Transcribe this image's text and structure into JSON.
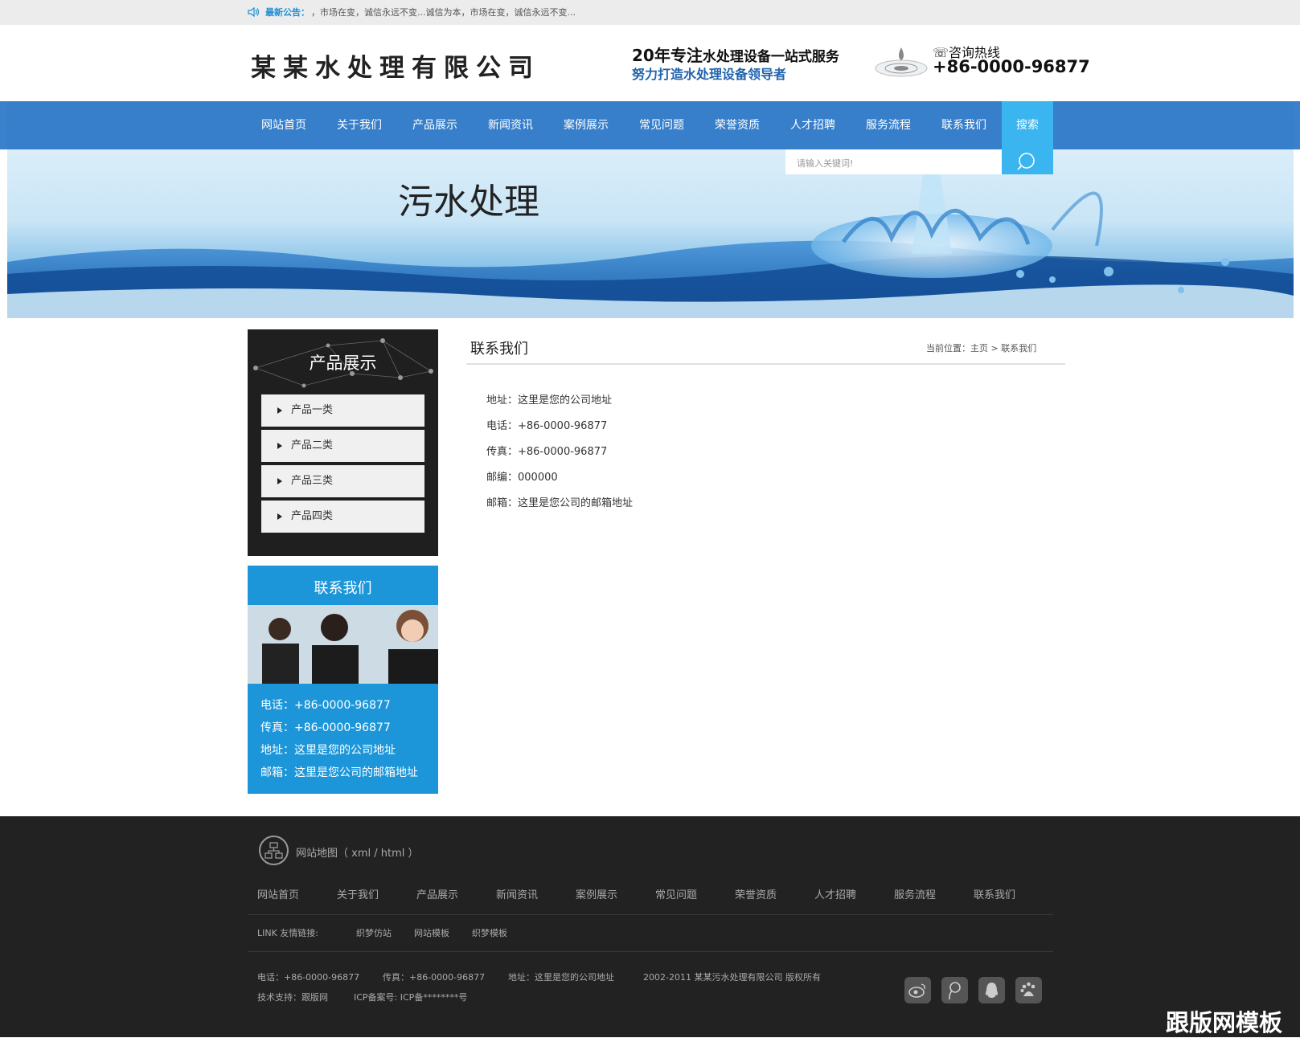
{
  "topbar": {
    "notice_label": "最新公告：",
    "notice_text": "，市场在变，诚信永远不变...诚信为本，市场在变，诚信永远不变..."
  },
  "header": {
    "company": "某某水处理有限公司",
    "slogan_line1_big": "20年专注",
    "slogan_line1_small": "水处理设备一站式服务",
    "slogan_line2": "努力打造水处理设备领导者",
    "hotline_label": "咨询热线",
    "hotline_number": "+86-0000-96877"
  },
  "nav": {
    "items": [
      "网站首页",
      "关于我们",
      "产品展示",
      "新闻资讯",
      "案例展示",
      "常见问题",
      "荣誉资质",
      "人才招聘",
      "服务流程",
      "联系我们"
    ],
    "search_label": "搜索",
    "search_placeholder": "请输入关键词!"
  },
  "banner": {
    "title": "污水处理"
  },
  "sidebar": {
    "products_title": "产品展示",
    "products": [
      "产品一类",
      "产品二类",
      "产品三类",
      "产品四类"
    ],
    "contact_title": "联系我们",
    "contact_lines": [
      "电话：+86-0000-96877",
      "传真：+86-0000-96877",
      "地址：这里是您的公司地址",
      "邮箱：这里是您公司的邮箱地址"
    ]
  },
  "main": {
    "title": "联系我们",
    "breadcrumb_prefix": "当前位置：",
    "breadcrumb_home": "主页",
    "breadcrumb_sep": ">",
    "breadcrumb_current": "联系我们",
    "info": [
      "地址：这里是您的公司地址",
      "电话：+86-0000-96877",
      "传真：+86-0000-96877",
      "邮编：000000",
      "邮箱：这里是您公司的邮箱地址"
    ]
  },
  "footer": {
    "sitemap": "网站地图（ xml / html ）",
    "nav": [
      "网站首页",
      "关于我们",
      "产品展示",
      "新闻资讯",
      "案例展示",
      "常见问题",
      "荣誉资质",
      "人才招聘",
      "服务流程",
      "联系我们"
    ],
    "links_label": "LINK 友情链接:",
    "links": [
      "织梦仿站",
      "网站模板",
      "织梦模板"
    ],
    "phone": "电话：+86-0000-96877",
    "fax": "传真：+86-0000-96877",
    "address": "地址：这里是您的公司地址",
    "copyright": "2002-2011 某某污水处理有限公司 版权所有",
    "support": "技术支持：跟版网",
    "icp": "ICP备案号: ICP备********号",
    "social_icons": [
      "weibo-icon",
      "tencent-weibo-icon",
      "qq-icon",
      "baidu-icon"
    ]
  },
  "watermark": "跟版网模板",
  "colors": {
    "nav_blue": "#2572c4",
    "accent_cyan": "#3ab5f0",
    "contact_blue": "#1d96d9",
    "footer_bg": "#222222"
  }
}
